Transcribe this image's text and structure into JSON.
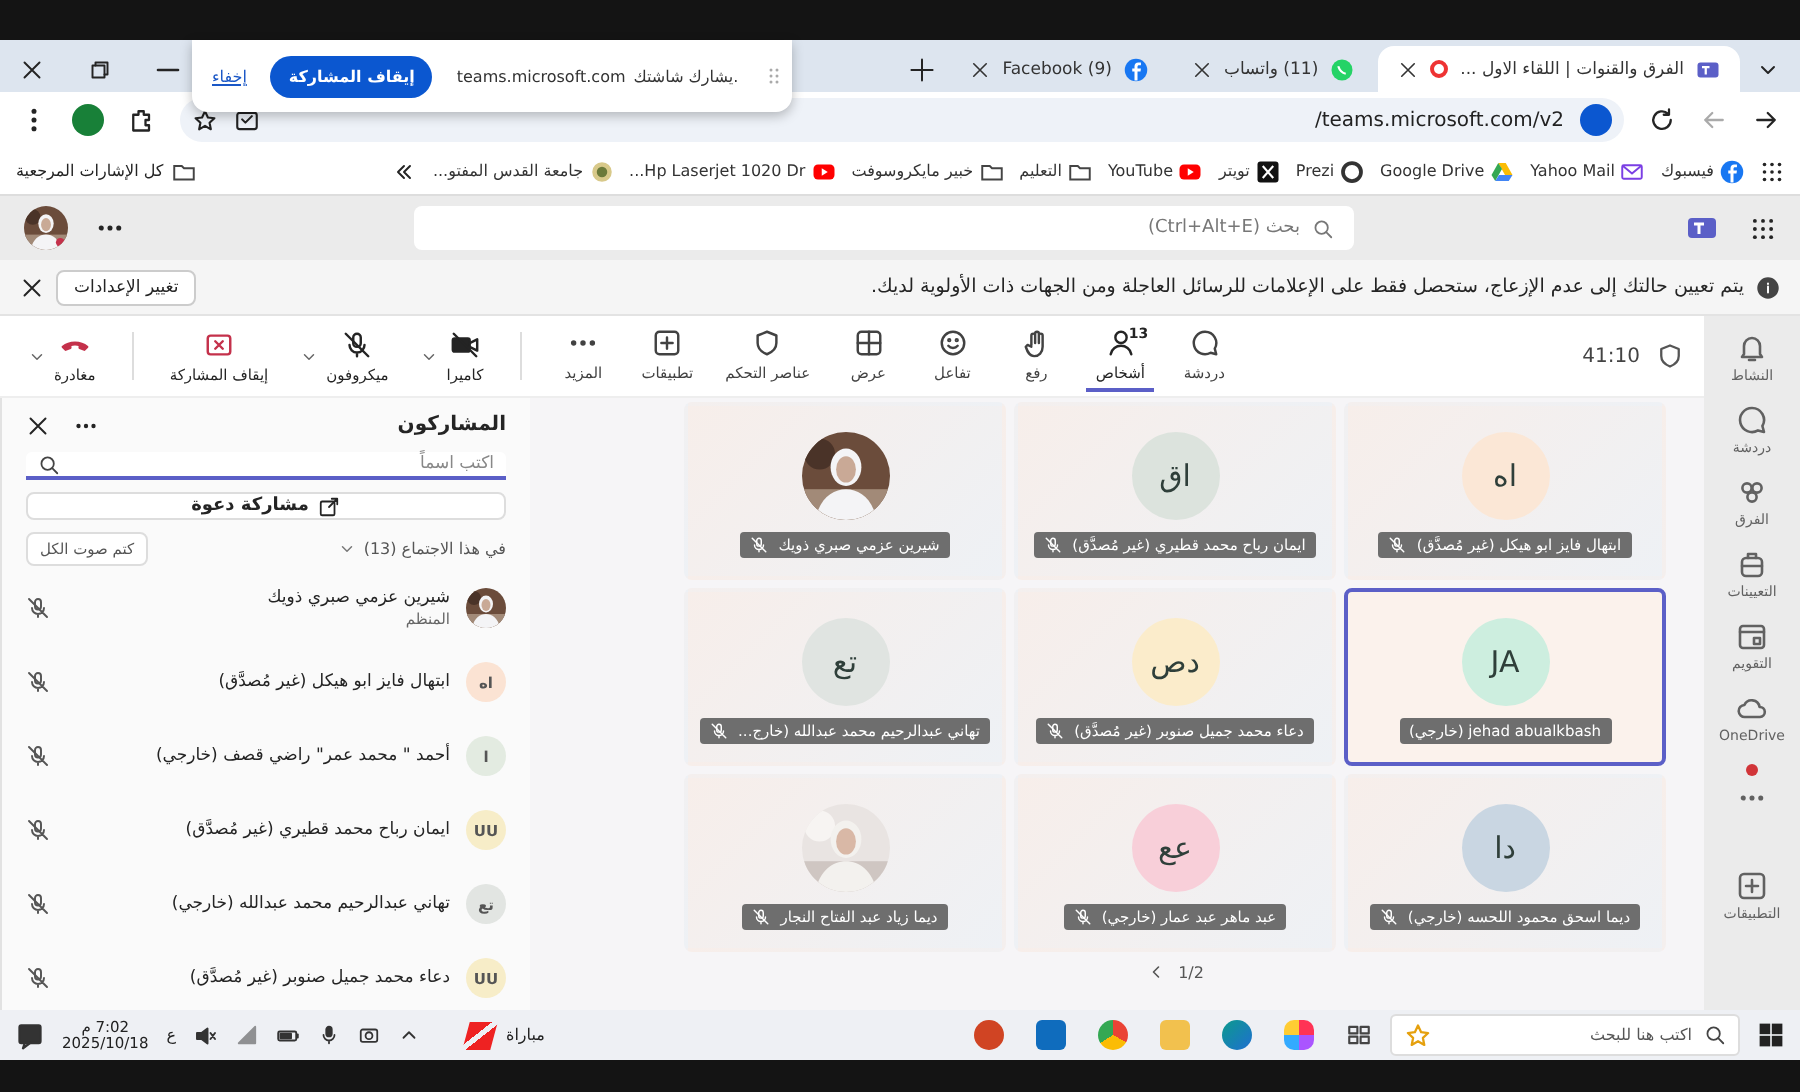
{
  "browser": {
    "tabs": [
      {
        "title": "الفرق والقنوات | اللقاء الاول ...",
        "kind": "teams",
        "recording": true,
        "selected": true
      },
      {
        "title": "(11) واتساب",
        "kind": "whatsapp",
        "recording": false,
        "selected": false
      },
      {
        "title": "(9) Facebook",
        "kind": "facebook",
        "recording": false,
        "selected": false
      }
    ],
    "share_prompt": {
      "message": "يشارك شاشتك.",
      "site": "teams.microsoft.com",
      "stop_button": "إيقاف المشاركة",
      "hide_link": "إخفاء"
    },
    "url": "teams.microsoft.com/v2/",
    "bookmarks": [
      {
        "label": "فيسبوك",
        "kind": "facebook"
      },
      {
        "label": "Yahoo Mail",
        "kind": "mail"
      },
      {
        "label": "Google Drive",
        "kind": "drive"
      },
      {
        "label": "Prezi",
        "kind": "circle"
      },
      {
        "label": "تويتر",
        "kind": "x"
      },
      {
        "label": "YouTube",
        "kind": "youtube"
      },
      {
        "label": "التعليم",
        "kind": "folder"
      },
      {
        "label": "خبير مايكروسوفت",
        "kind": "folder"
      },
      {
        "label": "Hp Laserjet 1020 Dr...",
        "kind": "youtube"
      },
      {
        "label": "جامعة القدس المفتو...",
        "kind": "emblem"
      }
    ],
    "all_bookmarks": "كل الإشارات المرجعية"
  },
  "teams": {
    "search_placeholder": "بحث (Ctrl+Alt+E)",
    "notice": "يتم تعيين حالتك إلى عدم الإزعاج، ستحصل فقط على الإعلامات للرسائل العاجلة ومن الجهات ذات الأولوية لديك.",
    "notice_button": "تغيير الإعدادات",
    "timer": "41:10",
    "toolbar": [
      {
        "label": "دردشة",
        "kind": "chat",
        "selected": false
      },
      {
        "label": "أشخاص",
        "kind": "person",
        "badge": "13",
        "selected": true
      },
      {
        "label": "رفع",
        "kind": "hand",
        "selected": false
      },
      {
        "label": "تفاعل",
        "kind": "smiley",
        "selected": false
      },
      {
        "label": "عرض",
        "kind": "grid",
        "selected": false
      },
      {
        "label": "عناصر التحكم",
        "kind": "shield",
        "selected": false
      },
      {
        "label": "تطبيقات",
        "kind": "plus",
        "selected": false
      },
      {
        "label": "المزيد",
        "kind": "more",
        "selected": false
      }
    ],
    "controls": [
      {
        "label": "كاميرا",
        "kind": "cameraoff",
        "caret": true
      },
      {
        "label": "ميكروفون",
        "kind": "micoff",
        "caret": true
      },
      {
        "label": "إيقاف المشاركة",
        "kind": "stopshare",
        "caret": false
      },
      {
        "label": "مغادرة",
        "kind": "phone",
        "caret": true
      }
    ]
  },
  "rail": [
    {
      "label": "النشاط",
      "kind": "bell"
    },
    {
      "label": "دردشة",
      "kind": "chat"
    },
    {
      "label": "الفرق",
      "kind": "people"
    },
    {
      "label": "التعيينات",
      "kind": "backpack"
    },
    {
      "label": "التقويم",
      "kind": "calendar"
    },
    {
      "label": "OneDrive",
      "kind": "cloud"
    },
    {
      "label": "التطبيقات",
      "kind": "plus"
    }
  ],
  "participants": {
    "title": "المشاركون",
    "search_placeholder": "اكتب اسماً",
    "invite_button": "مشاركة دعوة",
    "section": "في هذا الاجتماع (13)",
    "expanded": true,
    "mute_all": "كتم صوت الكل",
    "people": [
      {
        "name": "شيرين عزمي صبري ذويك",
        "role": "المنظم",
        "muted": true
      },
      {
        "name": "ابتهال فايز ابو هيكل (غير مُصدَّق)",
        "kind": "initials",
        "initials": "اه",
        "color": "#fbe3d3",
        "muted": true
      },
      {
        "name": "أحمد \" محمد عمر\" راضي قصف (خارجي)",
        "kind": "initials",
        "initials": "ا",
        "color": "#e3ebe1",
        "muted": true
      },
      {
        "name": "ايمان رباح محمد قطيري (غير مُصدَّق)",
        "kind": "initials",
        "initials": "UU",
        "color": "#f7edc8",
        "muted": true
      },
      {
        "name": "تهاني عبدالرحيم محمد عبدالله (خارجي)",
        "kind": "initials",
        "initials": "تع",
        "color": "#e2e5e2",
        "muted": true
      },
      {
        "name": "دعاء محمد جميل صنوبر (غير مُصدَّق)",
        "kind": "initials",
        "initials": "UU",
        "color": "#f7edc8",
        "muted": true
      }
    ]
  },
  "stage": {
    "tiles": [
      {
        "name": "ابتهال فايز ابو هيكل (غير مُصدَّق)",
        "kind": "initials",
        "initials": "اه",
        "color": "#fbe7d6",
        "muted": true,
        "speaking": false
      },
      {
        "name": "ايمان رباح محمد قطيري (غير مُصدَّق)",
        "kind": "initials",
        "initials": "اق",
        "color": "#dce3dd",
        "muted": true,
        "speaking": false
      },
      {
        "name": "شيرين عزمي صبري ذويك",
        "muted": true,
        "speaking": false
      },
      {
        "name": "jehad abualkbash (خارجي)",
        "kind": "initials",
        "initials": "JA",
        "color": "#cdeedf",
        "muted": false,
        "speaking": true
      },
      {
        "name": "دعاء محمد جميل صنوبر (غير مُصدَّق)",
        "kind": "initials",
        "initials": "دص",
        "color": "#fbeccb",
        "muted": true,
        "speaking": false
      },
      {
        "name": "تهاني عبدالرحيم محمد عبدالله (خارج...",
        "kind": "initials",
        "initials": "تع",
        "color": "#e0e4e1",
        "muted": true,
        "speaking": false
      },
      {
        "name": "ديما اسحق محمود اللحسه (خارجي)",
        "kind": "initials",
        "initials": "دا",
        "color": "#c9d6e2",
        "muted": true,
        "speaking": false
      },
      {
        "name": "عبد ماهر عبد عمار (خارجي)",
        "kind": "initials",
        "initials": "عع",
        "color": "#f8cfd9",
        "muted": true,
        "speaking": false
      },
      {
        "name": "ديما زياد عبد الفتاح النجار",
        "muted": true,
        "speaking": false
      }
    ],
    "pager": "1/2"
  },
  "taskbar": {
    "search_placeholder": "اكتب هنا للبحث",
    "weather": "مباراة",
    "time": "7:02 م",
    "date": "2025/10/18",
    "language": "ع"
  }
}
